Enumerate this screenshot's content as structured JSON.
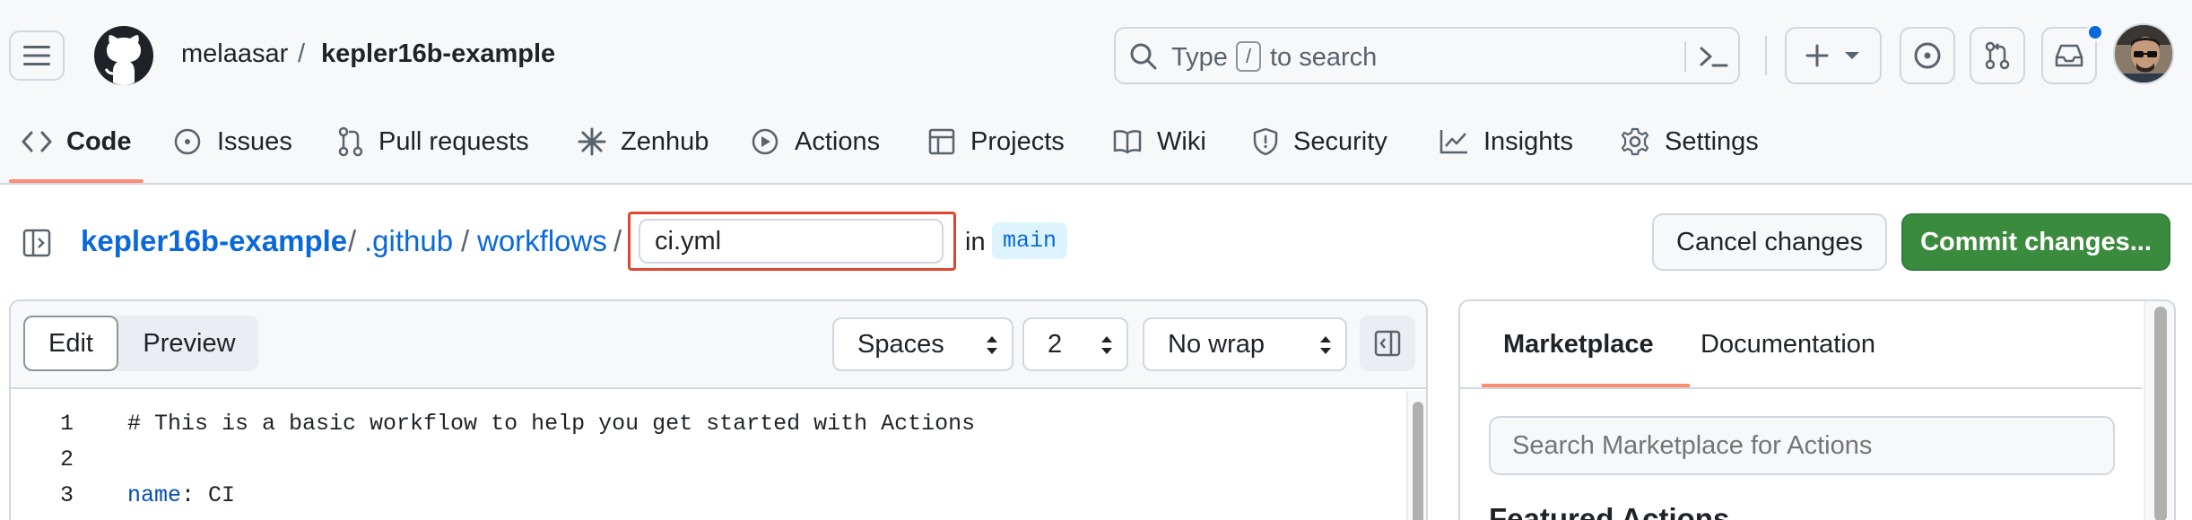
{
  "header": {
    "owner": "melaasar",
    "separator": "/",
    "repo": "kepler16b-example",
    "search": {
      "prefix": "Type",
      "key": "/",
      "suffix": "to search"
    },
    "icons": [
      "hamburger-icon",
      "github-logo-icon",
      "search-icon",
      "command-palette-icon",
      "plus-icon",
      "issues-icon",
      "pull-requests-icon",
      "inbox-icon"
    ]
  },
  "nav": {
    "code": "Code",
    "issues": "Issues",
    "pull_requests": "Pull requests",
    "zenhub": "Zenhub",
    "actions": "Actions",
    "projects": "Projects",
    "wiki": "Wiki",
    "security": "Security",
    "insights": "Insights",
    "settings": "Settings"
  },
  "editor_header": {
    "path_repo": "kepler16b-example",
    "path_github": ".github",
    "path_workflows": "workflows",
    "sep": "/",
    "filename": "ci.yml",
    "in_label": "in",
    "branch": "main",
    "cancel": "Cancel changes",
    "commit": "Commit changes..."
  },
  "editor": {
    "mode_edit": "Edit",
    "mode_preview": "Preview",
    "indent_mode": "Spaces",
    "indent_size": "2",
    "wrap_mode": "No wrap",
    "lines": [
      {
        "no": "1",
        "text": "# This is a basic workflow to help you get started with Actions"
      },
      {
        "no": "2",
        "text": ""
      },
      {
        "no": "3",
        "key": "name",
        "colon": ":",
        "value": " CI"
      }
    ]
  },
  "right_panel": {
    "tab_marketplace": "Marketplace",
    "tab_documentation": "Documentation",
    "search_placeholder": "Search Marketplace for Actions",
    "heading": "Featured Actions"
  },
  "colors": {
    "accent_link": "#0969da",
    "commit_green": "#3b8b3e",
    "nav_underline": "#fd8c73",
    "highlight_box": "#e0452f"
  }
}
